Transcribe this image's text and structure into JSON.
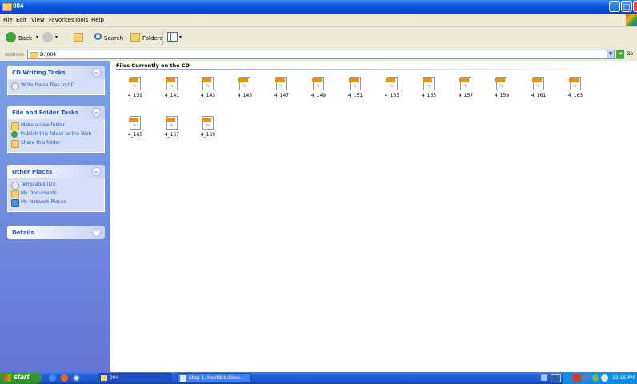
{
  "window": {
    "title": "004"
  },
  "menu": [
    "File",
    "Edit",
    "View",
    "Favorites",
    "Tools",
    "Help"
  ],
  "toolbar": {
    "back": "Back",
    "search": "Search",
    "folders": "Folders"
  },
  "address": {
    "label": "Address",
    "value": "D:\\004",
    "go": "Go"
  },
  "panels": {
    "cd": {
      "title": "CD Writing Tasks",
      "items": [
        "Write these files to CD"
      ]
    },
    "file": {
      "title": "File and Folder Tasks",
      "items": [
        "Make a new folder",
        "Publish this folder to the Web",
        "Share this folder"
      ]
    },
    "other": {
      "title": "Other Places",
      "items": [
        "Templates (D:)",
        "My Documents",
        "My Network Places"
      ]
    },
    "details": {
      "title": "Details"
    }
  },
  "section_title": "Files Currently on the CD",
  "files": [
    "4_139",
    "4_141",
    "4_143",
    "4_145",
    "4_147",
    "4_149",
    "4_151",
    "4_153",
    "4_155",
    "4_157",
    "4_159",
    "4_161",
    "4_163",
    "4_165",
    "4_167",
    "4_169"
  ],
  "taskbar": {
    "start": "start",
    "tasks": [
      "004",
      "Stap 1, hoofdstukken..."
    ],
    "clock": "12:15 PM"
  }
}
